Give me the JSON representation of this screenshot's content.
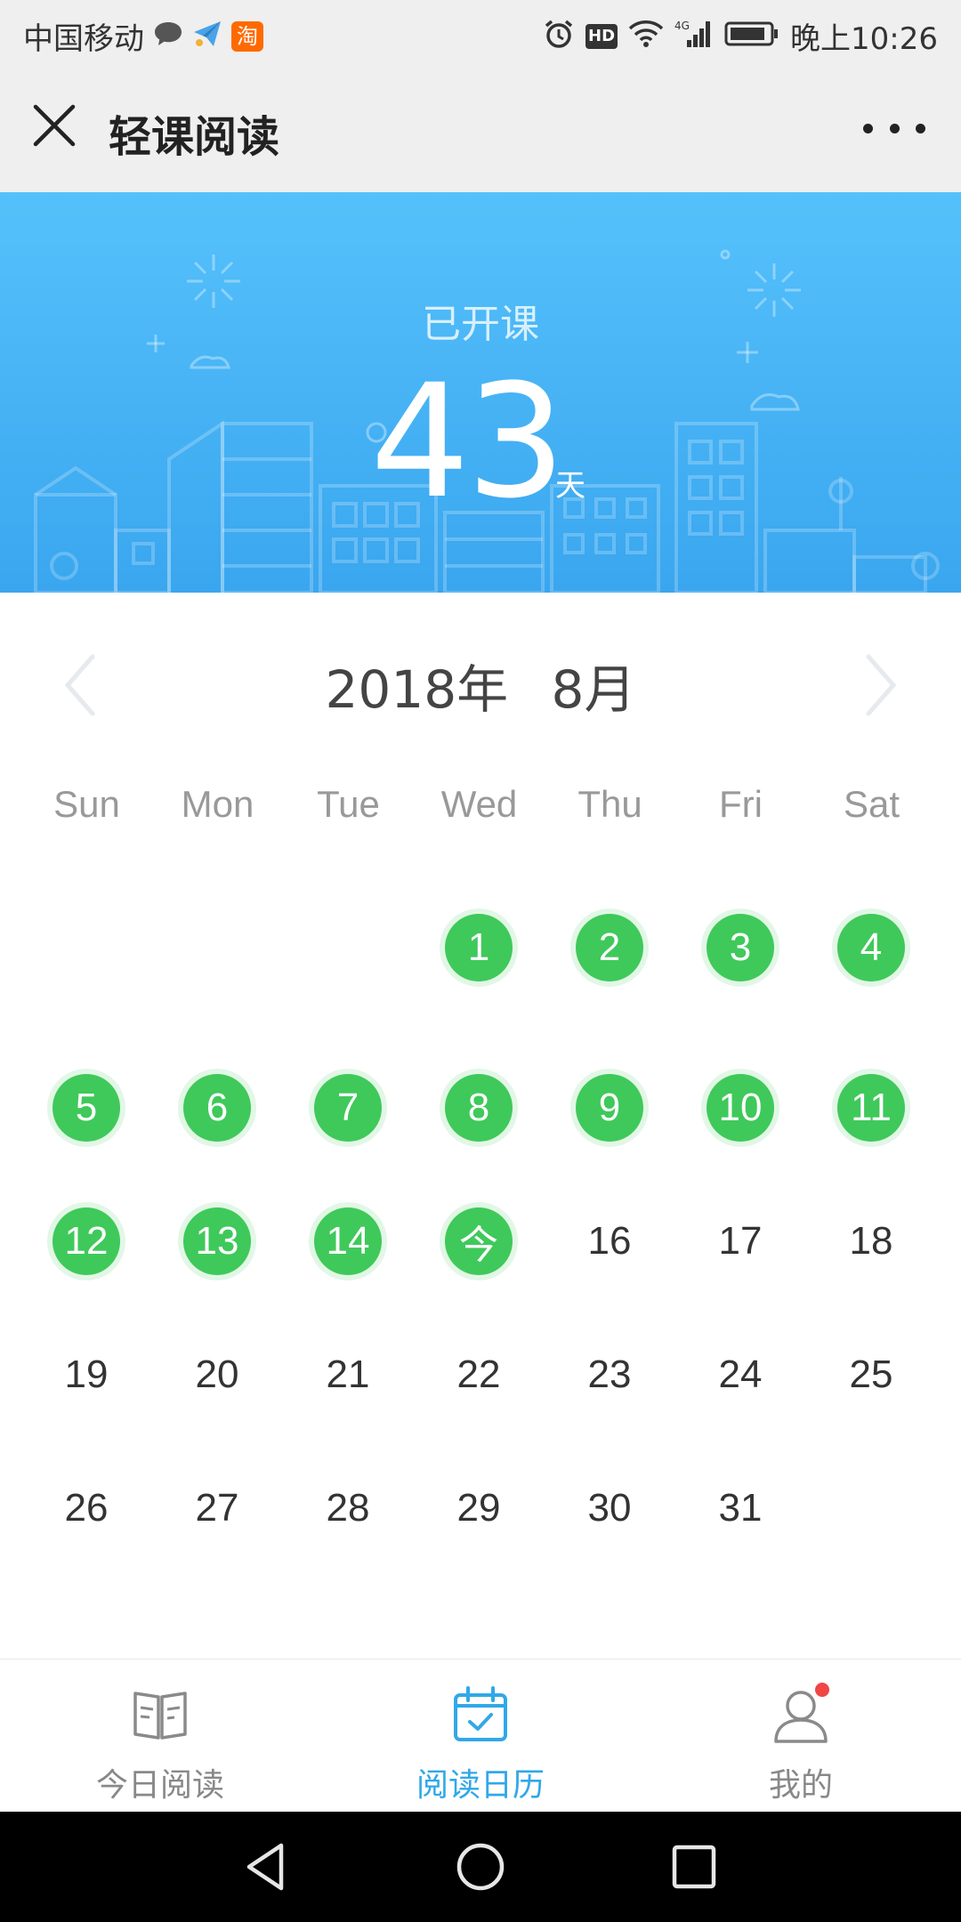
{
  "status_bar": {
    "carrier": "中国移动",
    "app_badge": "淘",
    "hd_label": "HD",
    "network": "4G",
    "time": "晚上10:26"
  },
  "title_bar": {
    "title": "轻课阅读"
  },
  "banner": {
    "label": "已开课",
    "count": "43",
    "unit": "天"
  },
  "calendar": {
    "month_title": "2018年 8月",
    "weekdays": [
      "Sun",
      "Mon",
      "Tue",
      "Wed",
      "Thu",
      "Fri",
      "Sat"
    ],
    "first_weekday_index": 3,
    "days": [
      "1",
      "2",
      "3",
      "4",
      "5",
      "6",
      "7",
      "8",
      "9",
      "10",
      "11",
      "12",
      "13",
      "14",
      "今",
      "16",
      "17",
      "18",
      "19",
      "20",
      "21",
      "22",
      "23",
      "24",
      "25",
      "26",
      "27",
      "28",
      "29",
      "30",
      "31"
    ],
    "completed_through_day": 15,
    "colors": {
      "completed": "#3fc95a",
      "completed_halo": "#e2f7e6"
    }
  },
  "bottom_nav": {
    "tabs": [
      {
        "label": "今日阅读",
        "icon": "open-book-icon",
        "active": false
      },
      {
        "label": "阅读日历",
        "icon": "calendar-check-icon",
        "active": true
      },
      {
        "label": "我的",
        "icon": "user-icon",
        "active": false,
        "has_notification": true
      }
    ],
    "accent_color": "#31a8e8"
  },
  "system_nav": {
    "buttons": [
      "back-icon",
      "home-icon",
      "recents-icon"
    ]
  }
}
